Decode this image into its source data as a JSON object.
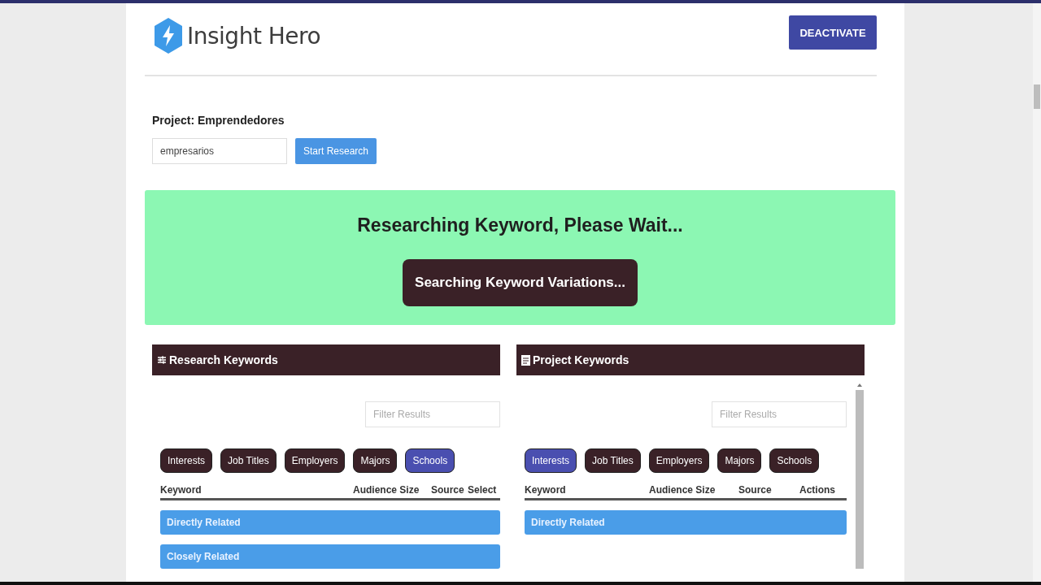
{
  "header": {
    "logo_text": "Insight Hero",
    "button": "DEACTIVATE"
  },
  "project": {
    "title": "Project: Emprendedores",
    "search_value": "empresarios",
    "button": "Start Research"
  },
  "status": {
    "message": "Researching Keyword, Please Wait...",
    "step": "Searching Keyword Variations..."
  },
  "panels": [
    {
      "kind": "research",
      "title": "Research Keywords",
      "filter_placeholder": "Filter Results",
      "tabs": [
        {
          "label": "Interests",
          "selected": false
        },
        {
          "label": "Job Titles",
          "selected": false
        },
        {
          "label": "Employers",
          "selected": false
        },
        {
          "label": "Majors",
          "selected": false
        },
        {
          "label": "Schools",
          "selected": true
        }
      ],
      "columns": [
        "Keyword",
        "Audience Size",
        "Source",
        "Select"
      ],
      "groups": [
        "Directly Related",
        "Closely Related"
      ]
    },
    {
      "kind": "project",
      "title": "Project Keywords",
      "filter_placeholder": "Filter Results",
      "tabs": [
        {
          "label": "Interests",
          "selected": true
        },
        {
          "label": "Job Titles",
          "selected": false
        },
        {
          "label": "Employers",
          "selected": false
        },
        {
          "label": "Majors",
          "selected": false
        },
        {
          "label": "Schools",
          "selected": false
        }
      ],
      "columns": [
        "Keyword",
        "Audience Size",
        "Source",
        "Actions"
      ],
      "groups": [
        "Directly Related"
      ]
    }
  ]
}
